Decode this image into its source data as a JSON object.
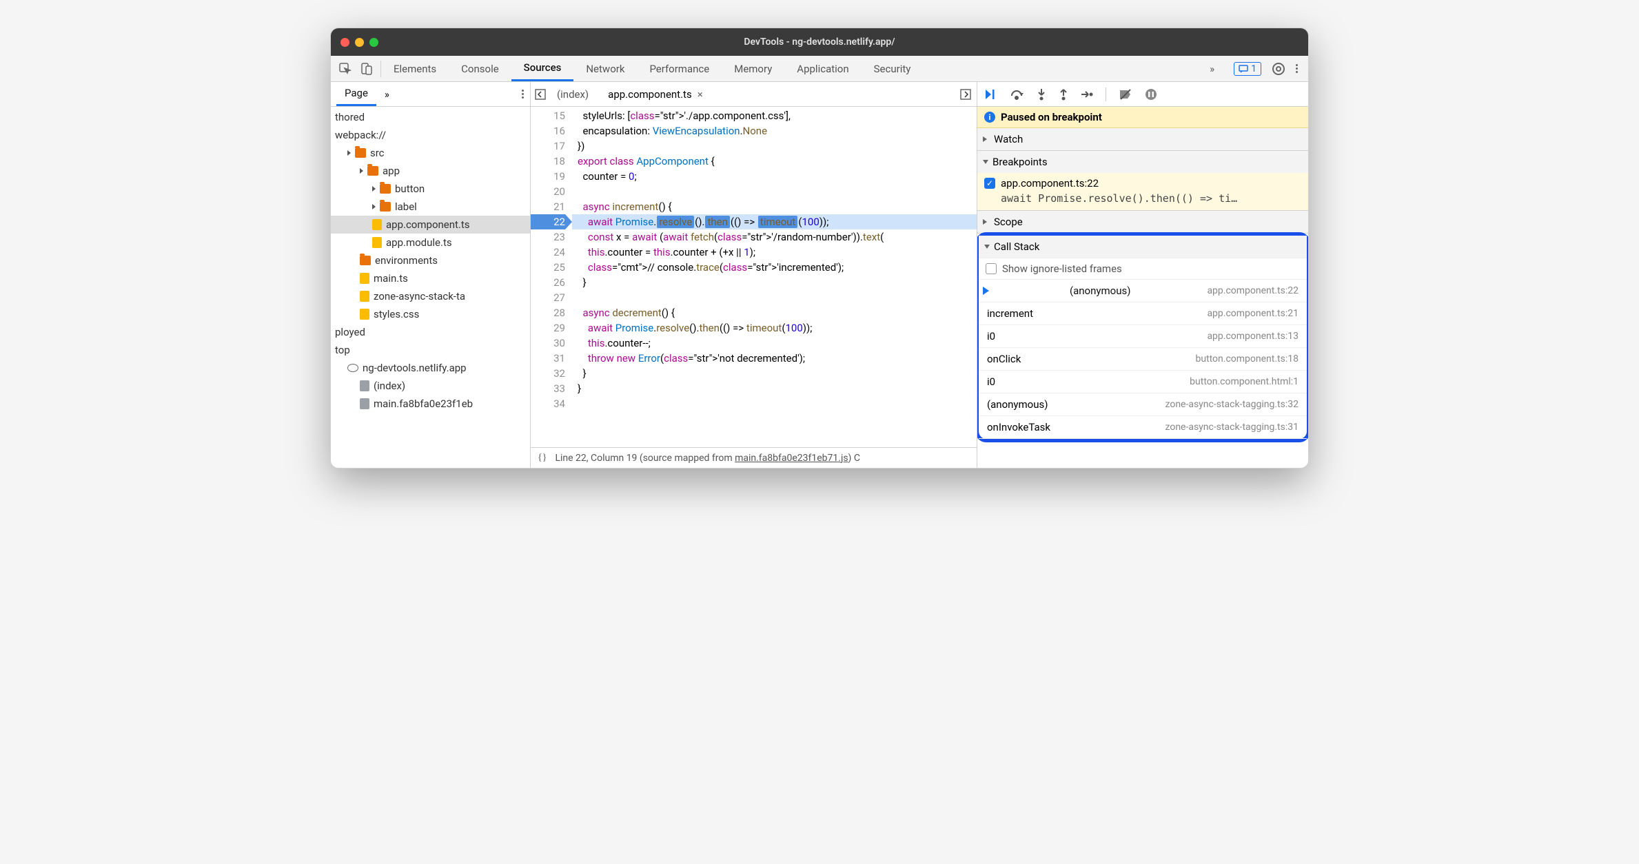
{
  "window_title": "DevTools - ng-devtools.netlify.app/",
  "tabs": [
    "Elements",
    "Console",
    "Sources",
    "Network",
    "Performance",
    "Memory",
    "Application",
    "Security"
  ],
  "active_tab": "Sources",
  "overflow_glyph": "»",
  "messages_count": "1",
  "left_panel": {
    "tabs": [
      "Page"
    ],
    "overflow": "»",
    "tree": [
      {
        "label": "thored",
        "indent": 0,
        "icon": "none"
      },
      {
        "label": "webpack://",
        "indent": 0,
        "icon": "none"
      },
      {
        "label": "src",
        "indent": 1,
        "icon": "folder",
        "caret": true
      },
      {
        "label": "app",
        "indent": 2,
        "icon": "folder",
        "caret": true
      },
      {
        "label": "button",
        "indent": 3,
        "icon": "folder",
        "caret": true
      },
      {
        "label": "label",
        "indent": 3,
        "icon": "folder",
        "caret": true
      },
      {
        "label": "app.component.ts",
        "indent": 3,
        "icon": "file",
        "selected": true
      },
      {
        "label": "app.module.ts",
        "indent": 3,
        "icon": "file"
      },
      {
        "label": "environments",
        "indent": 2,
        "icon": "folder"
      },
      {
        "label": "main.ts",
        "indent": 2,
        "icon": "file"
      },
      {
        "label": "zone-async-stack-ta",
        "indent": 2,
        "icon": "file"
      },
      {
        "label": "styles.css",
        "indent": 2,
        "icon": "file"
      },
      {
        "label": "ployed",
        "indent": 0,
        "icon": "none"
      },
      {
        "label": "top",
        "indent": 0,
        "icon": "none"
      },
      {
        "label": "ng-devtools.netlify.app",
        "indent": 1,
        "icon": "cloud"
      },
      {
        "label": "(index)",
        "indent": 2,
        "icon": "file-gray"
      },
      {
        "label": "main.fa8bfa0e23f1eb",
        "indent": 2,
        "icon": "file-gray"
      }
    ]
  },
  "editor": {
    "open_tabs": [
      {
        "label": "(index)",
        "active": false
      },
      {
        "label": "app.component.ts",
        "active": true,
        "close": "×"
      }
    ],
    "first_line": 15,
    "current_line": 22,
    "lines": [
      "  styleUrls: ['./app.component.css'],",
      "  encapsulation: ViewEncapsulation.None",
      "})",
      "export class AppComponent {",
      "  counter = 0;",
      "",
      "  async increment() {",
      "    await Promise.resolve().then(() => timeout(100));",
      "    const x = await (await fetch('/random-number')).text(",
      "    this.counter = this.counter + (+x || 1);",
      "    // console.trace('incremented');",
      "  }",
      "",
      "  async decrement() {",
      "    await Promise.resolve().then(() => timeout(100));",
      "    this.counter--;",
      "    throw new Error('not decremented');",
      "  }",
      "}",
      ""
    ],
    "status_prefix": "{}",
    "status": "Line 22, Column 19  (source mapped from ",
    "status_link": "main.fa8bfa0e23f1eb71.js",
    "status_suffix": ")  C"
  },
  "debugger": {
    "paused_label": "Paused on breakpoint",
    "sections": {
      "watch": "Watch",
      "breakpoints": "Breakpoints",
      "scope": "Scope",
      "call_stack": "Call Stack"
    },
    "breakpoint": {
      "file": "app.component.ts:22",
      "code": "await Promise.resolve().then(() => ti…"
    },
    "show_ignore_label": "Show ignore-listed frames",
    "frames": [
      {
        "name": "(anonymous)",
        "loc": "app.component.ts:22",
        "current": true
      },
      {
        "name": "increment",
        "loc": "app.component.ts:21"
      },
      {
        "name": "i0",
        "loc": "app.component.ts:13"
      },
      {
        "name": "onClick",
        "loc": "button.component.ts:18"
      },
      {
        "name": "i0",
        "loc": "button.component.html:1"
      },
      {
        "name": "(anonymous)",
        "loc": "zone-async-stack-tagging.ts:32"
      },
      {
        "name": "onInvokeTask",
        "loc": "zone-async-stack-tagging.ts:31"
      }
    ]
  }
}
